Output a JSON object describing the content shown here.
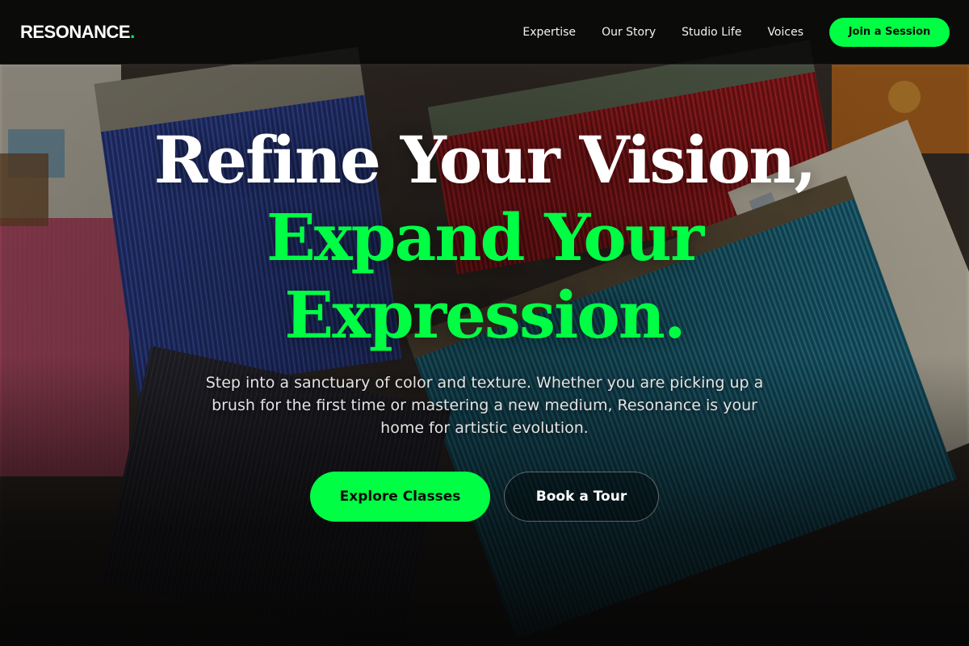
{
  "brand": {
    "name": "RESONANCE",
    "dot": "."
  },
  "nav": {
    "links": [
      "Expertise",
      "Our Story",
      "Studio Life",
      "Voices"
    ],
    "cta_label": "Join a Session"
  },
  "hero": {
    "heading_line_1": "Refine Your Vision,",
    "heading_line_2": "Expand Your",
    "heading_line_3": "Expression.",
    "subtext": "Step into a sanctuary of color and texture. Whether you are picking up a brush for the first time or mastering a new medium, Resonance is your home for artistic evolution.",
    "primary_button_label": "Explore Classes",
    "secondary_button_label": "Book a Tour",
    "background_image": "paint-brushes-photo"
  },
  "colors": {
    "accent": "#00ff44",
    "header_background": "#080808",
    "text_primary": "#ffffff"
  }
}
